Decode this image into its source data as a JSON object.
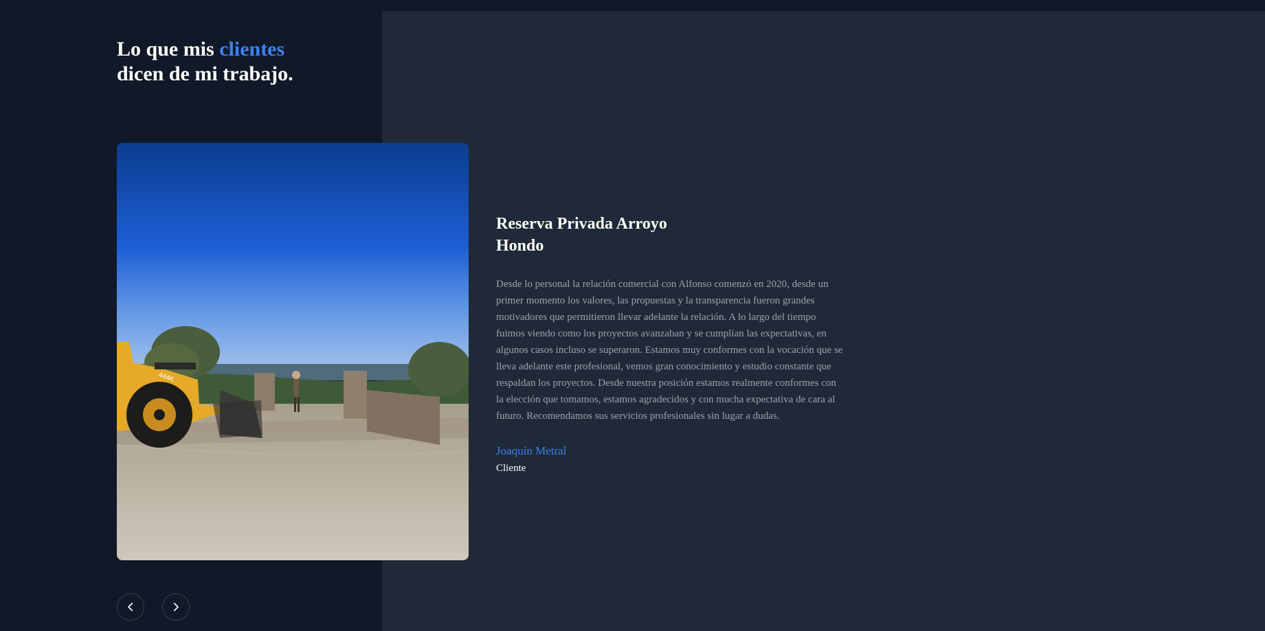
{
  "section": {
    "heading_prefix": "Lo que mis",
    "heading_accent": "clientes",
    "heading_line2": "dicen de mi trabajo."
  },
  "testimonial": {
    "title": "Reserva Privada Arroyo Hondo",
    "quote": "Desde lo personal la relación comercial con Alfonso comenzó en 2020, desde un primer momento los valores, las propuestas y la transparencia fueron grandes motivadores que permitieron llevar adelante la relación. A lo largo del tiempo fuimos viendo como los proyectos avanzaban y se cumplían las expectativas, en algunos casos incluso se superaron. Estamos muy conformes con la vocación que se lleva adelante este profesional, vemos gran conocimiento y estudio constante que respaldan los proyectos. Desde nuestra posición estamos realmente conformes con la elección que tomamos, estamos agradecidos y con mucha expectativa de cara al futuro. Recomendamos sus servicios profesionales sin lugar a dudas.",
    "author": "Joaquín Metral",
    "role": "Cliente",
    "photo_label": "444K"
  },
  "controls": {
    "prev_icon": "chevron-left-icon",
    "next_icon": "chevron-right-icon"
  },
  "colors": {
    "background": "#111827",
    "panel": "#1f2937",
    "accent": "#3b82f6",
    "text_muted": "#9ca3af"
  }
}
